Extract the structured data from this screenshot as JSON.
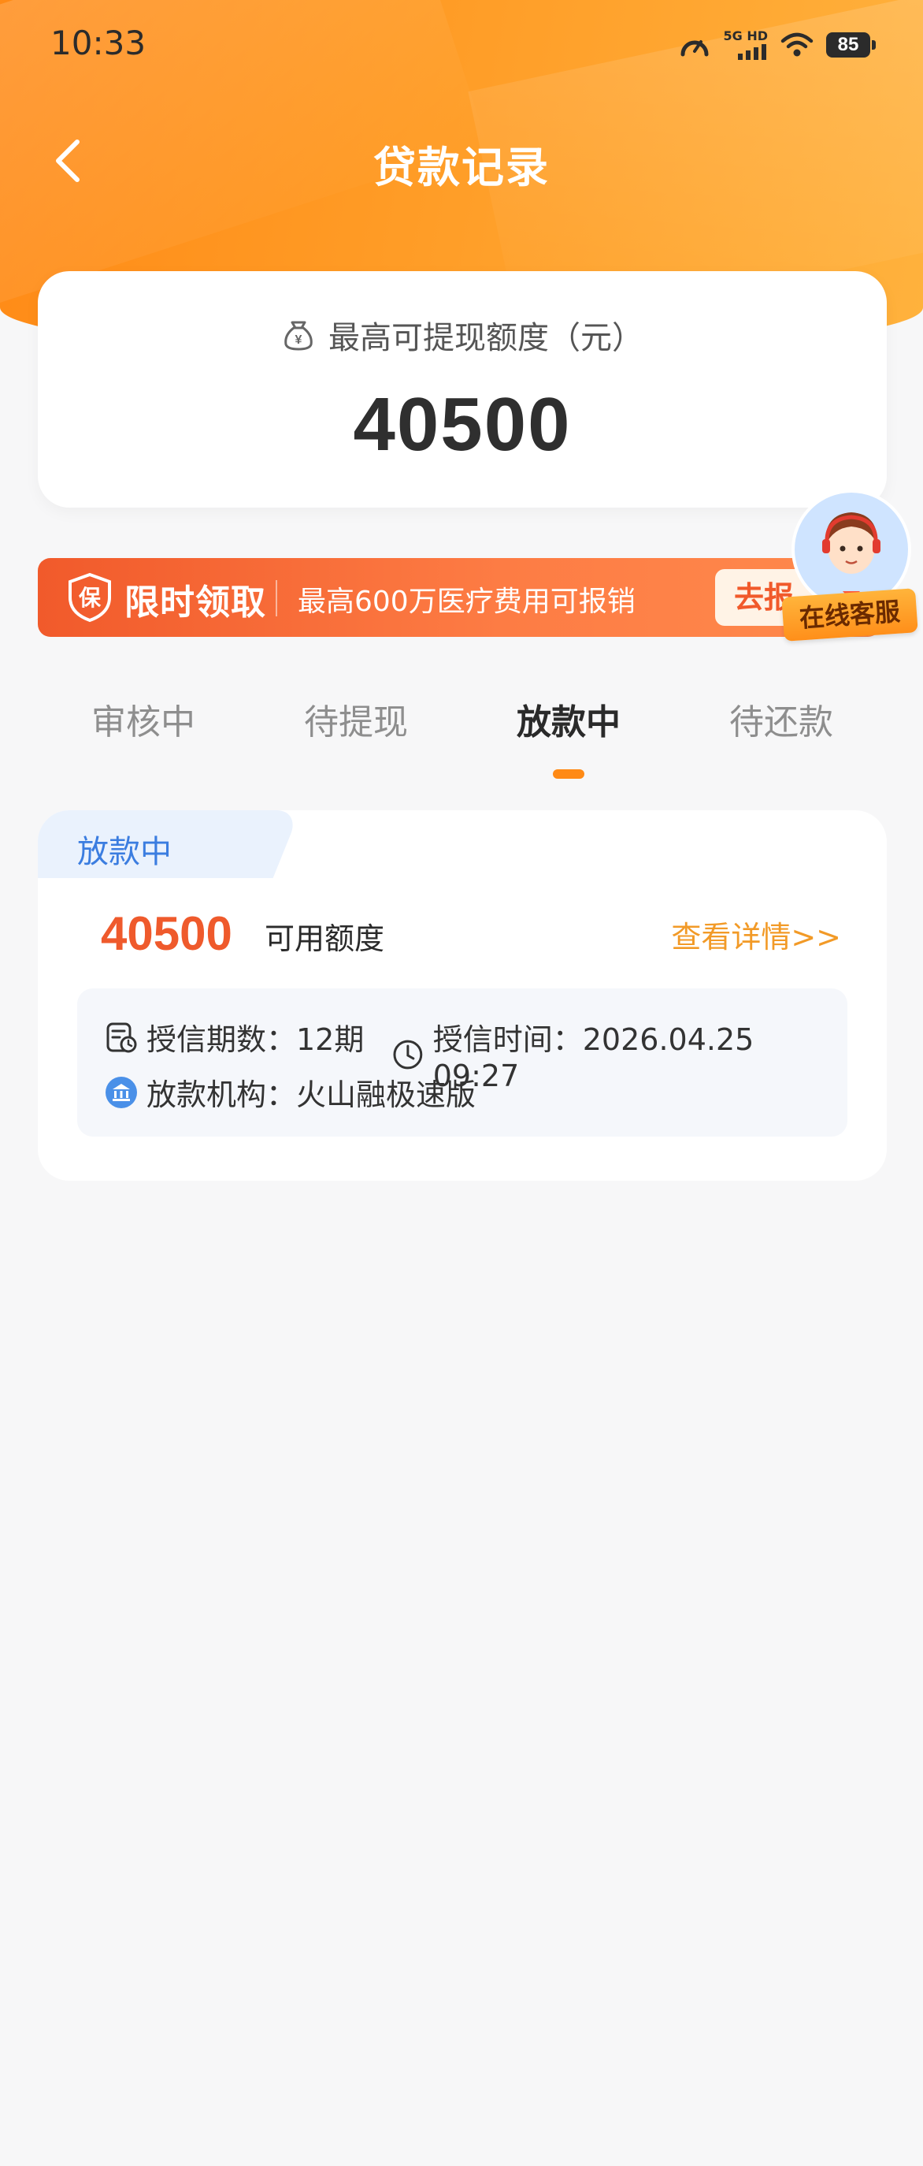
{
  "status_bar": {
    "time": "10:33",
    "network": "5G HD",
    "battery": "85",
    "icons": [
      "speed-icon",
      "signal-icon",
      "wifi-icon",
      "battery-icon"
    ]
  },
  "nav": {
    "title": "贷款记录",
    "back_icon": "chevron-left-icon"
  },
  "limit_card": {
    "label": "最高可提现额度（元）",
    "amount": "40500",
    "icon": "money-bag-icon"
  },
  "promo": {
    "badge_char": "保",
    "title": "限时领取",
    "description": "最高600万医疗费用可报销",
    "button": "去报"
  },
  "customer_service": {
    "label": "在线客服"
  },
  "tabs": [
    {
      "label": "审核中",
      "active": false
    },
    {
      "label": "待提现",
      "active": false
    },
    {
      "label": "放款中",
      "active": true
    },
    {
      "label": "待还款",
      "active": false
    }
  ],
  "record": {
    "status_tag": "放款中",
    "amount": "40500",
    "amount_label": "可用额度",
    "detail_link": "查看详情>>",
    "term_label": "授信期数：12期",
    "time_label": "授信时间：2026.04.25 09:27",
    "institution_label": "放款机构：火山融极速版"
  },
  "colors": {
    "brand_orange": "#ff8a16",
    "amount_red": "#ef5a2c",
    "status_blue": "#3b7de0",
    "link_orange": "#f29a27"
  }
}
